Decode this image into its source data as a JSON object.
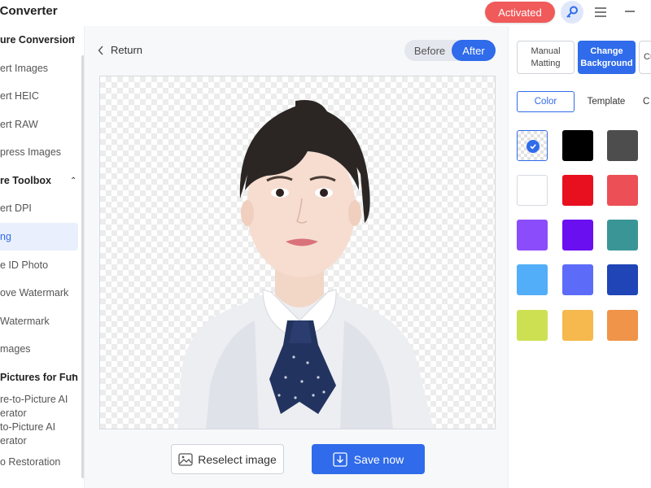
{
  "app": {
    "title": "ge Converter"
  },
  "titlebar": {
    "activated_label": "Activated"
  },
  "sidebar": {
    "items": [
      {
        "label": "ure Conversion",
        "section": true
      },
      {
        "label": "ert Images"
      },
      {
        "label": "ert HEIC"
      },
      {
        "label": "ert RAW"
      },
      {
        "label": "press Images"
      },
      {
        "label": "re Toolbox",
        "section": true
      },
      {
        "label": "ert DPI"
      },
      {
        "label": "ng",
        "active": true
      },
      {
        "label": "e ID Photo"
      },
      {
        "label": "ove Watermark"
      },
      {
        "label": "Watermark"
      },
      {
        "label": "mages"
      },
      {
        "label": "Pictures for Fun",
        "section": true
      },
      {
        "label": "re-to-Picture AI"
      },
      {
        "label": "erator"
      },
      {
        "label": "to-Picture AI"
      },
      {
        "label": "erator"
      },
      {
        "label": "o Restoration"
      }
    ]
  },
  "main": {
    "return_label": "Return",
    "toggle": {
      "before": "Before",
      "after": "After"
    },
    "reselect_label": "Reselect image",
    "save_label": "Save now"
  },
  "right_panel": {
    "modes": {
      "manual_line1": "Manual",
      "manual_line2": "Matting",
      "change_line1": "Change",
      "change_line2": "Background",
      "cut": "Cu"
    },
    "subtabs": {
      "color": "Color",
      "template": "Template",
      "more": "C"
    },
    "swatches": [
      {
        "color": "transparent",
        "selected": true
      },
      {
        "color": "#000000"
      },
      {
        "color": "#4d4d4d"
      },
      {
        "color": "#ffffff"
      },
      {
        "color": "#e8101f"
      },
      {
        "color": "#ec4f56"
      },
      {
        "color": "#8b4dfb"
      },
      {
        "color": "#6a0ff0"
      },
      {
        "color": "#3a9696"
      },
      {
        "color": "#52aef8"
      },
      {
        "color": "#5c6cf8"
      },
      {
        "color": "#1f45b6"
      },
      {
        "color": "#cde052"
      },
      {
        "color": "#f5b94d"
      },
      {
        "color": "#ef9448"
      }
    ]
  },
  "colors": {
    "accent": "#2f6bea",
    "activated": "#f05a5a"
  }
}
